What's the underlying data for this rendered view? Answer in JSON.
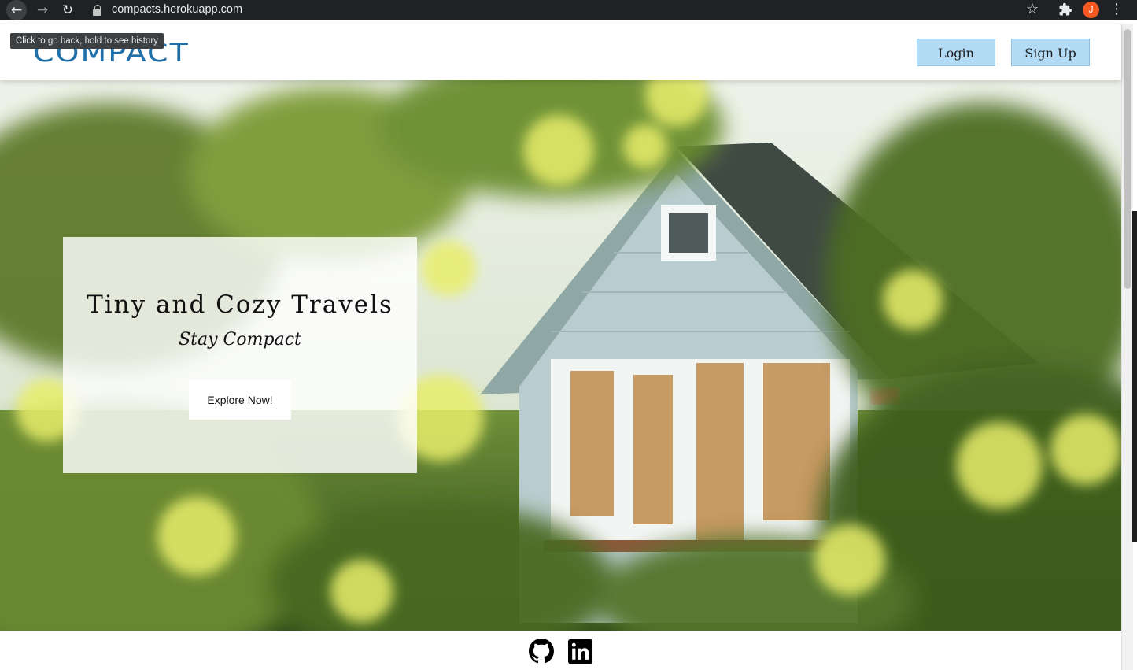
{
  "browser": {
    "url": "compacts.herokuapp.com",
    "tooltip": "Click to go back, hold to see history",
    "profile_initial": "J"
  },
  "header": {
    "logo": "COMPACT",
    "login_label": "Login",
    "signup_label": "Sign Up"
  },
  "hero": {
    "title": "Tiny and Cozy Travels",
    "subtitle": "Stay Compact",
    "cta_label": "Explore Now!"
  },
  "footer": {
    "icons": [
      "github-icon",
      "linkedin-icon"
    ]
  },
  "colors": {
    "header_button_bg": "#b3dbf5",
    "logo": "#1f6fa8",
    "chrome_bg": "#202124",
    "avatar_bg": "#f45a1f"
  }
}
